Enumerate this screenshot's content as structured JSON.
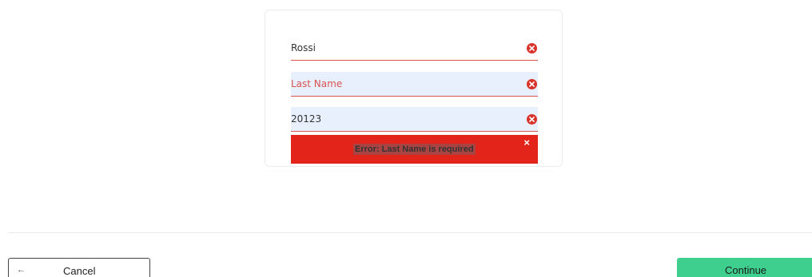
{
  "form": {
    "fields": [
      {
        "value": "Rossi",
        "placeholder": "",
        "state": "error"
      },
      {
        "value": "",
        "placeholder": "Last Name",
        "state": "error"
      },
      {
        "value": "20123",
        "placeholder": "",
        "state": "error"
      }
    ],
    "field1_text": "Rossi",
    "field2_placeholder": "Last Name",
    "field3_text": "20123",
    "error_icon": "error-circle-x-icon",
    "alert": {
      "message": "Error: Last Name is required",
      "close_glyph": "×"
    }
  },
  "footer": {
    "cancel_label": "Cancel",
    "cancel_icon": "arrow-left-icon",
    "cancel_glyph": "←",
    "continue_label": "Continue"
  },
  "colors": {
    "error": "#e3241b",
    "field_bg_autofill": "#e8f0fe",
    "continue_bg": "#3ecf8e"
  }
}
